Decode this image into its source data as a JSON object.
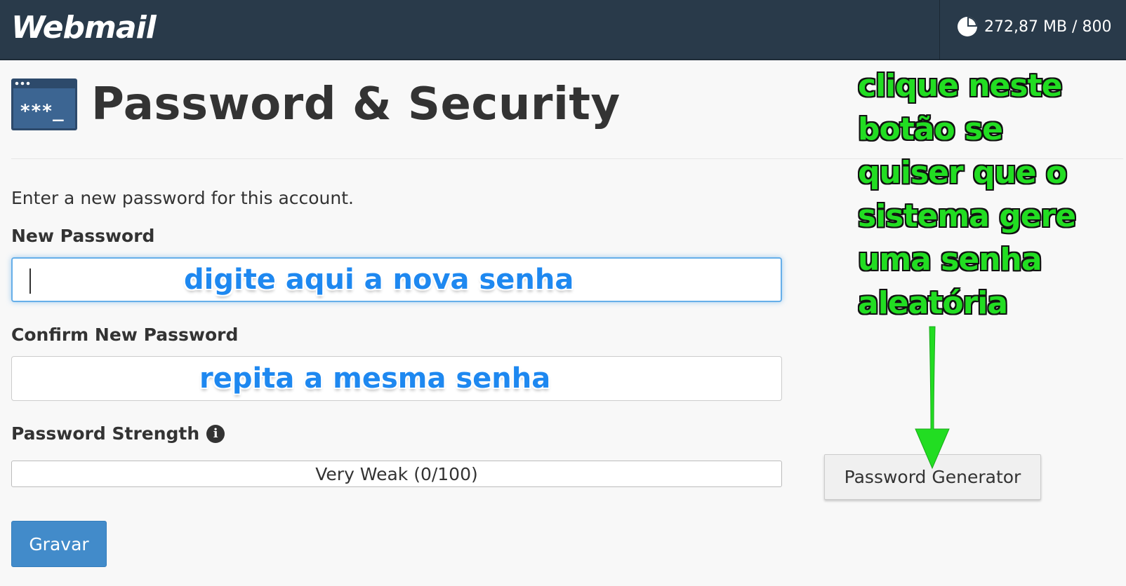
{
  "header": {
    "logo": "Webmail",
    "quota_text": "272,87 MB / 800"
  },
  "page": {
    "title": "Password & Security",
    "intro": "Enter a new password for this account."
  },
  "form": {
    "new_password_label": "New Password",
    "new_password_value": "",
    "confirm_password_label": "Confirm New Password",
    "confirm_password_value": "",
    "strength_label": "Password Strength",
    "strength_text": "Very Weak (0/100)",
    "strength_score": 0,
    "save_button": "Gravar",
    "generator_button": "Password Generator"
  },
  "annotations": {
    "new_password_hint": "digite aqui a nova senha",
    "confirm_password_hint": "repita a mesma senha",
    "generator_hint_lines": [
      "clique neste",
      "botão se",
      "quiser que o",
      "sistema gere",
      "uma senha",
      "aleatória"
    ]
  },
  "colors": {
    "topbar": "#293a4a",
    "primary_button": "#428bca",
    "focus_ring": "#66afe9",
    "annotation_blue": "#1e88f0",
    "annotation_green": "#22dd22"
  },
  "icons": {
    "quota": "pie-chart-icon",
    "title": "terminal-password-icon",
    "strength_info": "info-icon"
  }
}
